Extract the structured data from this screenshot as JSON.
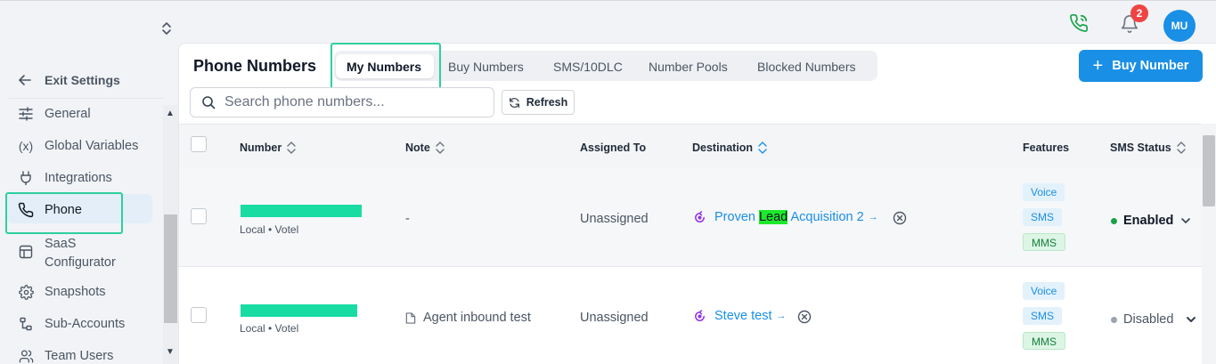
{
  "topbar": {
    "notification_count": "2",
    "avatar_initials": "MU"
  },
  "sidebar": {
    "exit_label": "Exit Settings",
    "items": [
      {
        "label": "General",
        "icon": "sliders-icon"
      },
      {
        "label": "Global Variables",
        "icon": "variable-icon"
      },
      {
        "label": "Integrations",
        "icon": "plug-icon"
      },
      {
        "label": "Phone",
        "icon": "phone-icon",
        "active": true
      },
      {
        "label": "SaaS Configurator",
        "icon": "layout-icon"
      },
      {
        "label": "Snapshots",
        "icon": "gear-icon"
      },
      {
        "label": "Sub-Accounts",
        "icon": "sub-accounts-icon"
      },
      {
        "label": "Team Users",
        "icon": "users-icon"
      }
    ],
    "saas_line1": "SaaS",
    "saas_line2": "Configurator"
  },
  "main": {
    "title": "Phone Numbers",
    "tabs": [
      {
        "label": "My Numbers",
        "active": true
      },
      {
        "label": "Buy Numbers"
      },
      {
        "label": "SMS/10DLC"
      },
      {
        "label": "Number Pools"
      },
      {
        "label": "Blocked Numbers"
      }
    ],
    "buy_button": "Buy Number",
    "search_placeholder": "Search phone numbers...",
    "refresh_label": "Refresh"
  },
  "table": {
    "columns": [
      "Number",
      "Note",
      "Assigned To",
      "Destination",
      "Features",
      "SMS Status"
    ],
    "rows": [
      {
        "number_sub": "Local • Votel",
        "note": "-",
        "assigned": "Unassigned",
        "destination_pre": "Proven ",
        "destination_highlight": "Lead",
        "destination_post": " Acquisition 2",
        "features": [
          "Voice",
          "SMS",
          "MMS"
        ],
        "sms_status": "Enabled"
      },
      {
        "number_sub": "Local • Votel",
        "note": "Agent inbound test",
        "assigned": "Unassigned",
        "destination_pre": "Steve test",
        "features": [
          "Voice",
          "SMS",
          "MMS"
        ],
        "sms_status": "Disabled"
      }
    ]
  },
  "colors": {
    "accent": "#1a8fe6",
    "highlight_outline": "#2ecf9f",
    "enabled": "#16a34a",
    "disabled": "#9ca3af",
    "redaction": "#19dca3"
  },
  "arrow_glyph": "→"
}
